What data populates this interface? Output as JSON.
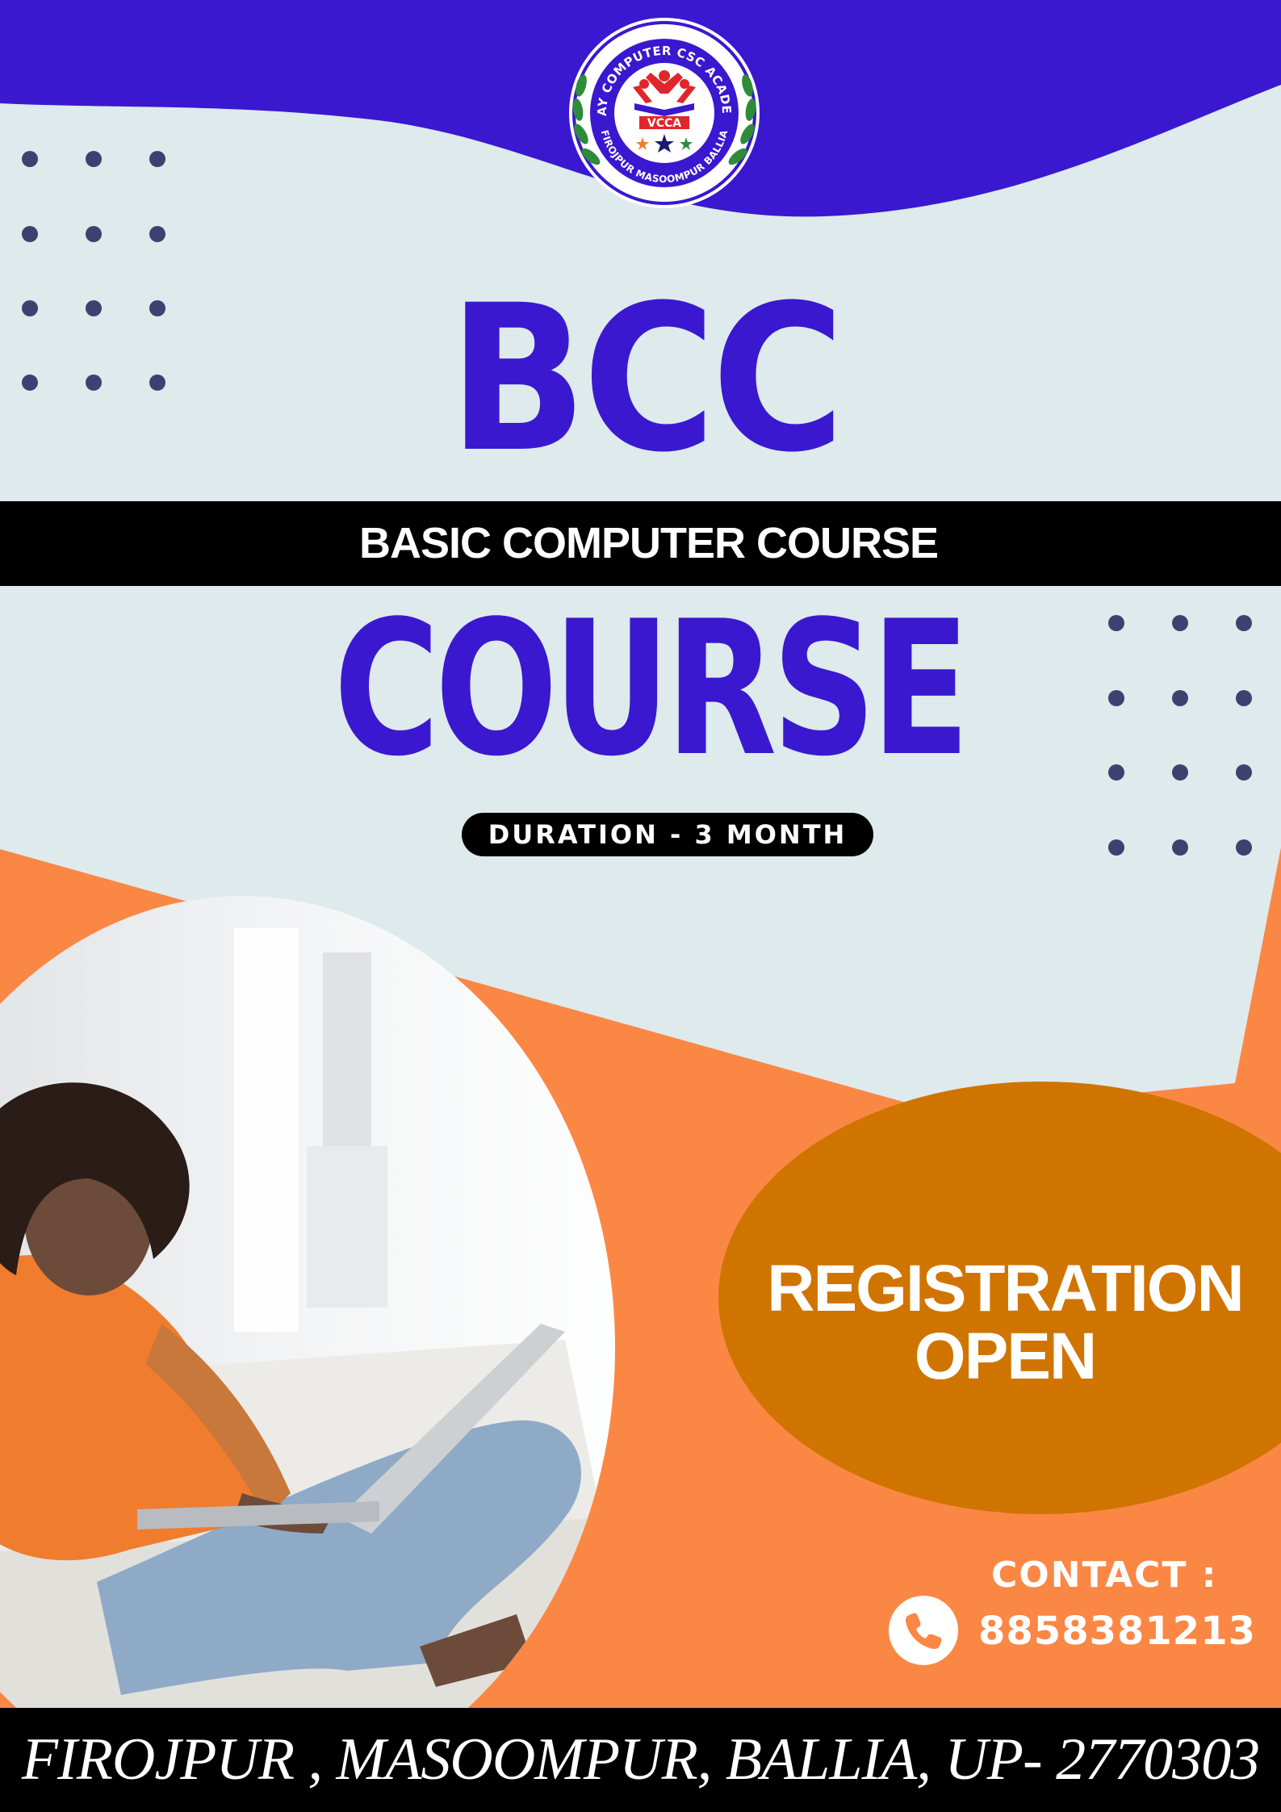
{
  "logo": {
    "ring_text_top": "VIJAY COMPUTER CSC ACADEMY",
    "ring_text_bottom": "FIROJPUR MASOOMPUR BALLIA",
    "badge": "VCCA"
  },
  "headline": {
    "title": "BCC",
    "subtitle": "BASIC COMPUTER COURSE",
    "course": "COURSE",
    "duration": "DURATION - 3 MONTH"
  },
  "registration": {
    "line1": "REGISTRATION",
    "line2": "OPEN"
  },
  "contact": {
    "label": "CONTACT :",
    "phone": "8858381213",
    "icon": "phone-icon"
  },
  "footer": {
    "address": "FIROJPUR , MASOOMPUR, BALLIA, UP- 2770303"
  },
  "colors": {
    "primary_blue": "#3a18cf",
    "background": "#deeaec",
    "orange": "#fb8745",
    "dark_orange": "#d07400",
    "dots": "#3c4270",
    "black": "#000000",
    "white": "#ffffff"
  }
}
